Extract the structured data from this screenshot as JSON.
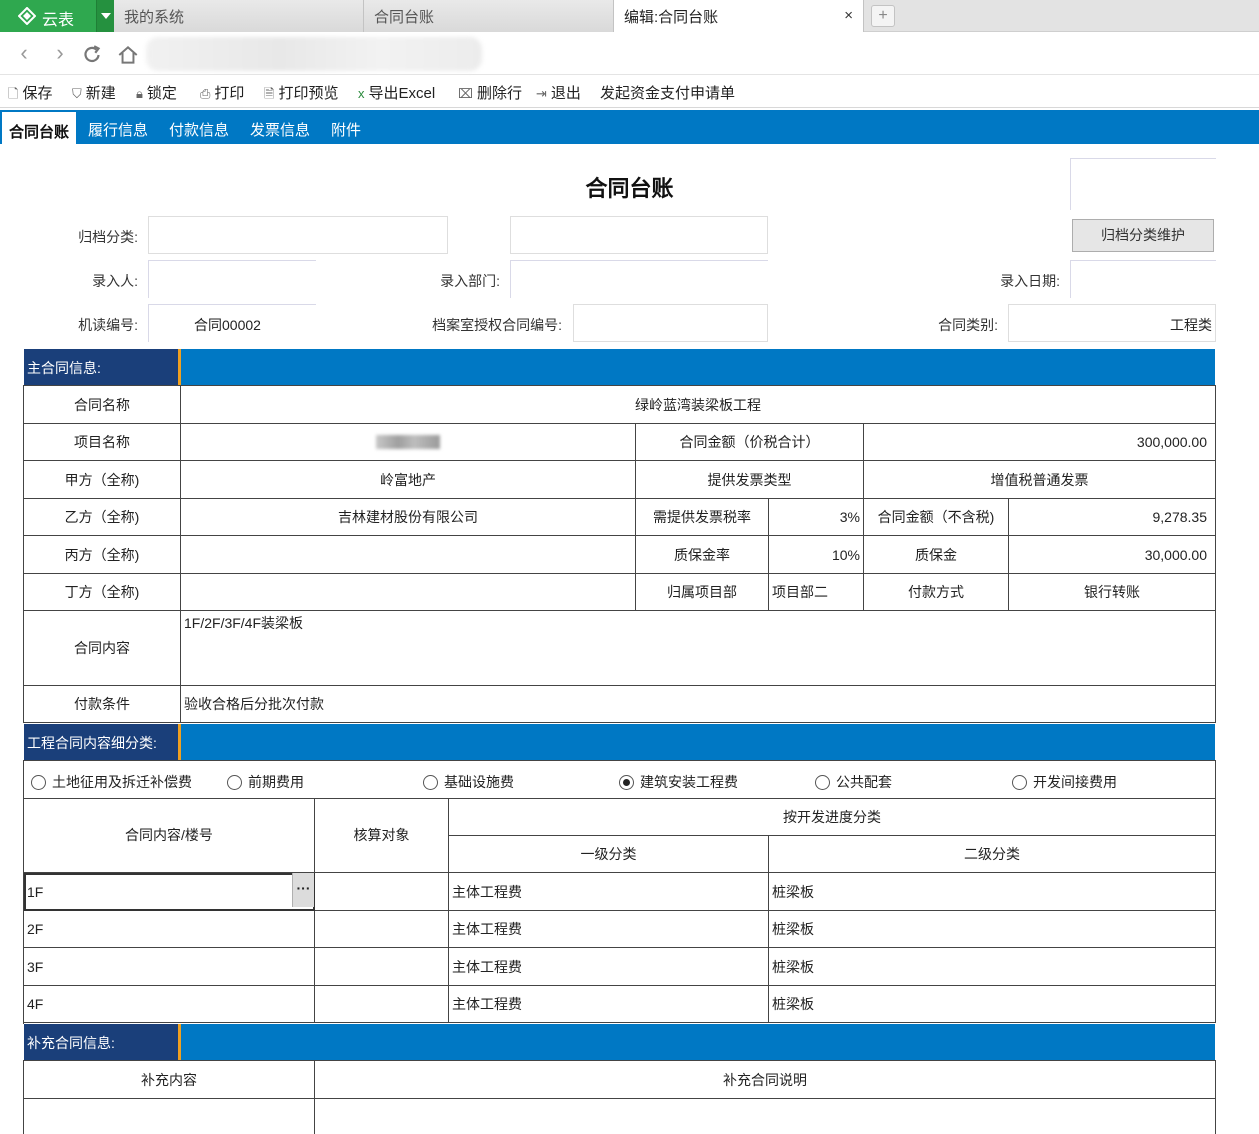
{
  "browser": {
    "brand": "云表",
    "tabs": [
      "我的系统",
      "合同台账",
      "编辑:合同台账"
    ],
    "close_glyph": "×",
    "new_tab_glyph": "+"
  },
  "toolbar": {
    "save": "保存",
    "new": "新建",
    "lock": "锁定",
    "print": "打印",
    "print_preview": "打印预览",
    "export_excel": "导出Excel",
    "delete_row": "删除行",
    "exit": "退出",
    "payment_request": "发起资金支付申请单"
  },
  "form_tabs": [
    "合同台账",
    "履行信息",
    "付款信息",
    "发票信息",
    "附件"
  ],
  "form": {
    "title": "合同台账",
    "archive_category_label": "归档分类:",
    "archive_category_value": "",
    "archive_category_value2": "",
    "archive_maintain_button": "归档分类维护",
    "entered_by_label": "录入人:",
    "entered_by_value": "",
    "entry_dept_label": "录入部门:",
    "entry_dept_value": "",
    "entry_date_label": "录入日期:",
    "entry_date_value": "",
    "machine_no_label": "机读编号:",
    "machine_no_value": "合同00002",
    "archive_auth_label": "档案室授权合同编号:",
    "archive_auth_value": "",
    "contract_type_label": "合同类别:",
    "contract_type_value": "工程类"
  },
  "main_section": {
    "label": "主合同信息:",
    "contract_name_label": "合同名称",
    "contract_name": "绿岭蓝湾装梁板工程",
    "project_name_label": "项目名称",
    "amount_incl_label": "合同金额（价税合计）",
    "amount_incl": "300,000.00",
    "party_a_label": "甲方（全称)",
    "party_a": "岭富地产",
    "invoice_type_label": "提供发票类型",
    "invoice_type": "增值税普通发票",
    "party_b_label": "乙方（全称)",
    "party_b": "吉林建材股份有限公司",
    "tax_rate_label": "需提供发票税率",
    "tax_rate": "3%",
    "amount_excl_label": "合同金额（不含税)",
    "amount_excl": "9,278.35",
    "party_c_label": "丙方（全称)",
    "party_c": "",
    "retention_rate_label": "质保金率",
    "retention_rate": "10%",
    "retention_label": "质保金",
    "retention": "30,000.00",
    "party_d_label": "丁方（全称)",
    "party_d": "",
    "dept_label": "归属项目部",
    "dept": "项目部二",
    "pay_method_label": "付款方式",
    "pay_method": "银行转账",
    "content_label": "合同内容",
    "content": "1F/2F/3F/4F装梁板",
    "pay_terms_label": "付款条件",
    "pay_terms": "验收合格后分批次付款"
  },
  "detail_section": {
    "label": "工程合同内容细分类:",
    "radios": [
      {
        "label": "土地征用及拆迁补偿费",
        "checked": false
      },
      {
        "label": "前期费用",
        "checked": false
      },
      {
        "label": "基础设施费",
        "checked": false
      },
      {
        "label": "建筑安装工程费",
        "checked": true
      },
      {
        "label": "公共配套",
        "checked": false
      },
      {
        "label": "开发间接费用",
        "checked": false
      }
    ],
    "col_content": "合同内容/楼号",
    "col_target": "核算对象",
    "col_group": "按开发进度分类",
    "col_level1": "一级分类",
    "col_level2": "二级分类",
    "ellipsis": "···",
    "rows": [
      {
        "content": "1F",
        "target": "",
        "level1": "主体工程费",
        "level2": "桩梁板"
      },
      {
        "content": "2F",
        "target": "",
        "level1": "主体工程费",
        "level2": "桩梁板"
      },
      {
        "content": "3F",
        "target": "",
        "level1": "主体工程费",
        "level2": "桩梁板"
      },
      {
        "content": "4F",
        "target": "",
        "level1": "主体工程费",
        "level2": "桩梁板"
      }
    ]
  },
  "supp_section": {
    "label": "补充合同信息:",
    "col_content": "补充内容",
    "col_desc": "补充合同说明"
  }
}
